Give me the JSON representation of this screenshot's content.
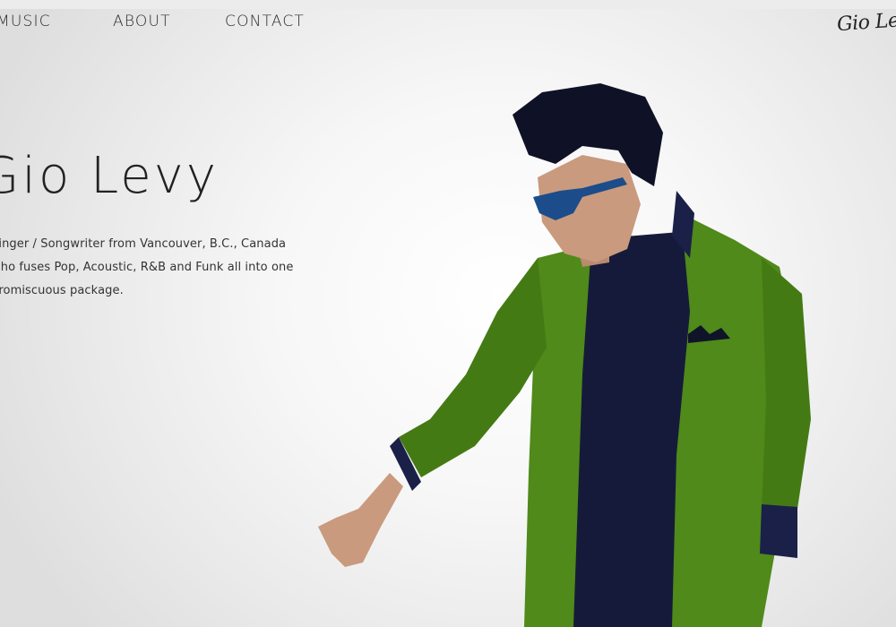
{
  "nav": {
    "items": [
      {
        "label": "MUSIC"
      },
      {
        "label": "ABOUT"
      },
      {
        "label": "CONTACT"
      }
    ]
  },
  "logo": {
    "text": "Gio Levy"
  },
  "hero": {
    "title": "Gio Levy",
    "bio_lines": [
      "Singer / Songwriter from Vancouver, B.C., Canada",
      "who fuses Pop, Acoustic, R&B and Funk all into one",
      "promiscuous package."
    ]
  },
  "photo": {
    "subject": "artist-portrait"
  },
  "colors": {
    "jacket": "#4f8a1a",
    "shirt": "#161a3a",
    "hair": "#0f1226",
    "background": "#f4f4f4"
  }
}
